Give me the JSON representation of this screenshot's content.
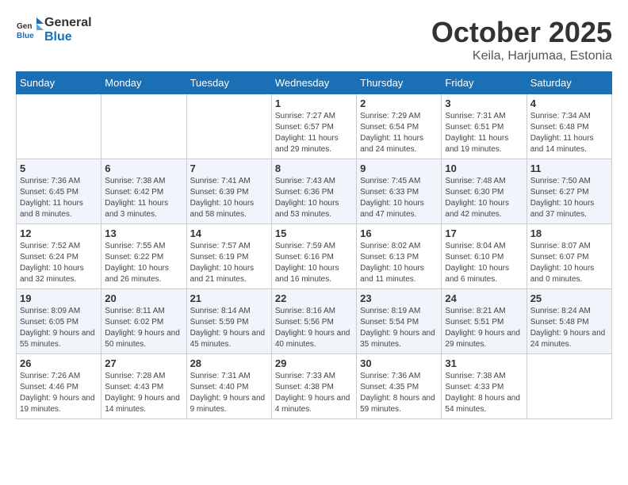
{
  "header": {
    "logo_general": "General",
    "logo_blue": "Blue",
    "month": "October 2025",
    "location": "Keila, Harjumaa, Estonia"
  },
  "weekdays": [
    "Sunday",
    "Monday",
    "Tuesday",
    "Wednesday",
    "Thursday",
    "Friday",
    "Saturday"
  ],
  "weeks": [
    [
      {
        "day": "",
        "info": ""
      },
      {
        "day": "",
        "info": ""
      },
      {
        "day": "",
        "info": ""
      },
      {
        "day": "1",
        "info": "Sunrise: 7:27 AM\nSunset: 6:57 PM\nDaylight: 11 hours and 29 minutes."
      },
      {
        "day": "2",
        "info": "Sunrise: 7:29 AM\nSunset: 6:54 PM\nDaylight: 11 hours and 24 minutes."
      },
      {
        "day": "3",
        "info": "Sunrise: 7:31 AM\nSunset: 6:51 PM\nDaylight: 11 hours and 19 minutes."
      },
      {
        "day": "4",
        "info": "Sunrise: 7:34 AM\nSunset: 6:48 PM\nDaylight: 11 hours and 14 minutes."
      }
    ],
    [
      {
        "day": "5",
        "info": "Sunrise: 7:36 AM\nSunset: 6:45 PM\nDaylight: 11 hours and 8 minutes."
      },
      {
        "day": "6",
        "info": "Sunrise: 7:38 AM\nSunset: 6:42 PM\nDaylight: 11 hours and 3 minutes."
      },
      {
        "day": "7",
        "info": "Sunrise: 7:41 AM\nSunset: 6:39 PM\nDaylight: 10 hours and 58 minutes."
      },
      {
        "day": "8",
        "info": "Sunrise: 7:43 AM\nSunset: 6:36 PM\nDaylight: 10 hours and 53 minutes."
      },
      {
        "day": "9",
        "info": "Sunrise: 7:45 AM\nSunset: 6:33 PM\nDaylight: 10 hours and 47 minutes."
      },
      {
        "day": "10",
        "info": "Sunrise: 7:48 AM\nSunset: 6:30 PM\nDaylight: 10 hours and 42 minutes."
      },
      {
        "day": "11",
        "info": "Sunrise: 7:50 AM\nSunset: 6:27 PM\nDaylight: 10 hours and 37 minutes."
      }
    ],
    [
      {
        "day": "12",
        "info": "Sunrise: 7:52 AM\nSunset: 6:24 PM\nDaylight: 10 hours and 32 minutes."
      },
      {
        "day": "13",
        "info": "Sunrise: 7:55 AM\nSunset: 6:22 PM\nDaylight: 10 hours and 26 minutes."
      },
      {
        "day": "14",
        "info": "Sunrise: 7:57 AM\nSunset: 6:19 PM\nDaylight: 10 hours and 21 minutes."
      },
      {
        "day": "15",
        "info": "Sunrise: 7:59 AM\nSunset: 6:16 PM\nDaylight: 10 hours and 16 minutes."
      },
      {
        "day": "16",
        "info": "Sunrise: 8:02 AM\nSunset: 6:13 PM\nDaylight: 10 hours and 11 minutes."
      },
      {
        "day": "17",
        "info": "Sunrise: 8:04 AM\nSunset: 6:10 PM\nDaylight: 10 hours and 6 minutes."
      },
      {
        "day": "18",
        "info": "Sunrise: 8:07 AM\nSunset: 6:07 PM\nDaylight: 10 hours and 0 minutes."
      }
    ],
    [
      {
        "day": "19",
        "info": "Sunrise: 8:09 AM\nSunset: 6:05 PM\nDaylight: 9 hours and 55 minutes."
      },
      {
        "day": "20",
        "info": "Sunrise: 8:11 AM\nSunset: 6:02 PM\nDaylight: 9 hours and 50 minutes."
      },
      {
        "day": "21",
        "info": "Sunrise: 8:14 AM\nSunset: 5:59 PM\nDaylight: 9 hours and 45 minutes."
      },
      {
        "day": "22",
        "info": "Sunrise: 8:16 AM\nSunset: 5:56 PM\nDaylight: 9 hours and 40 minutes."
      },
      {
        "day": "23",
        "info": "Sunrise: 8:19 AM\nSunset: 5:54 PM\nDaylight: 9 hours and 35 minutes."
      },
      {
        "day": "24",
        "info": "Sunrise: 8:21 AM\nSunset: 5:51 PM\nDaylight: 9 hours and 29 minutes."
      },
      {
        "day": "25",
        "info": "Sunrise: 8:24 AM\nSunset: 5:48 PM\nDaylight: 9 hours and 24 minutes."
      }
    ],
    [
      {
        "day": "26",
        "info": "Sunrise: 7:26 AM\nSunset: 4:46 PM\nDaylight: 9 hours and 19 minutes."
      },
      {
        "day": "27",
        "info": "Sunrise: 7:28 AM\nSunset: 4:43 PM\nDaylight: 9 hours and 14 minutes."
      },
      {
        "day": "28",
        "info": "Sunrise: 7:31 AM\nSunset: 4:40 PM\nDaylight: 9 hours and 9 minutes."
      },
      {
        "day": "29",
        "info": "Sunrise: 7:33 AM\nSunset: 4:38 PM\nDaylight: 9 hours and 4 minutes."
      },
      {
        "day": "30",
        "info": "Sunrise: 7:36 AM\nSunset: 4:35 PM\nDaylight: 8 hours and 59 minutes."
      },
      {
        "day": "31",
        "info": "Sunrise: 7:38 AM\nSunset: 4:33 PM\nDaylight: 8 hours and 54 minutes."
      },
      {
        "day": "",
        "info": ""
      }
    ]
  ]
}
